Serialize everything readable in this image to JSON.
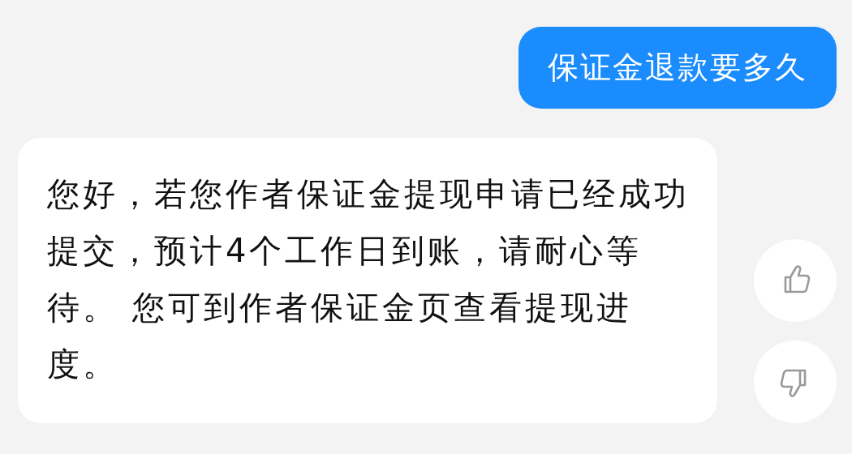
{
  "messages": [
    {
      "kind": "user",
      "text": "保证金退款要多久"
    },
    {
      "kind": "bot",
      "text": "您好，若您作者保证金提现申请已经成功提交，预计4个工作日到账，请耐心等待。 您可到作者保证金页查看提现进度。"
    }
  ]
}
